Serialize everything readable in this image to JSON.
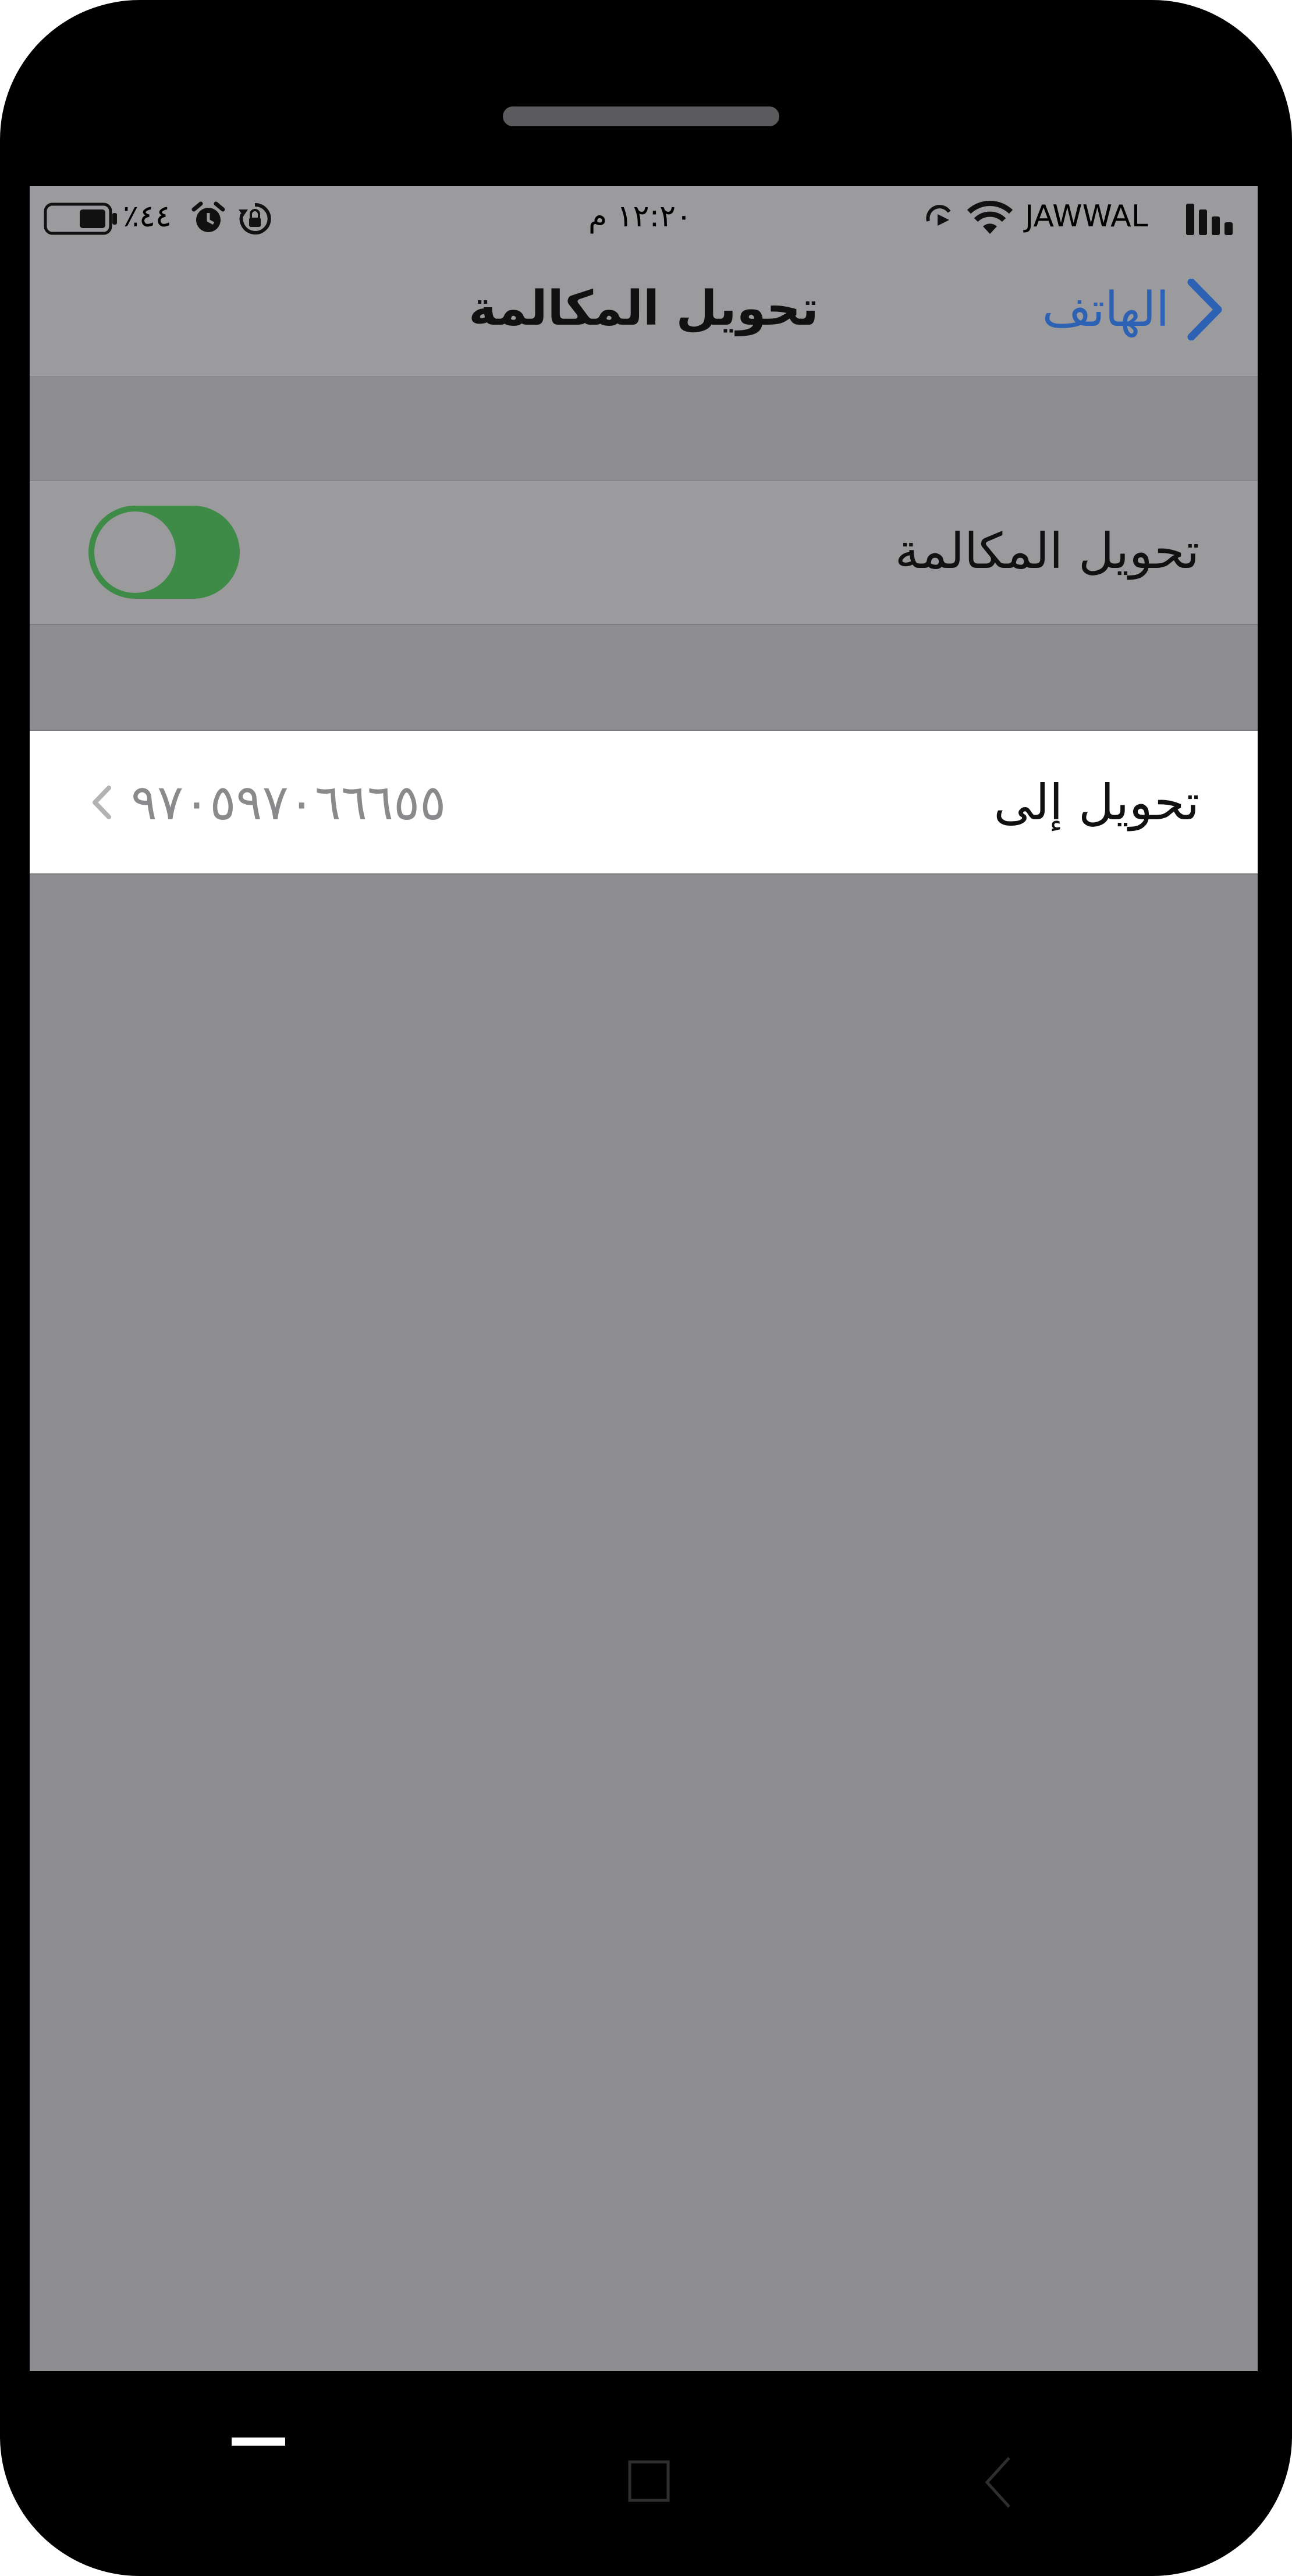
{
  "status_bar": {
    "carrier": "JAWWAL",
    "time": "١٢:٢٠ م",
    "battery": "٪٤٤",
    "icons": [
      "signal-bars-icon",
      "wifi-icon",
      "call-forward-icon",
      "rotation-lock-icon",
      "alarm-icon",
      "battery-icon"
    ]
  },
  "nav": {
    "back_label": "الهاتف",
    "title": "تحويل المكالمة"
  },
  "settings": {
    "forwarding": {
      "label": "تحويل المكالمة",
      "enabled": true
    },
    "forward_to": {
      "label": "تحويل إلى",
      "value": "٩٧٠٥٩٧٠٦٦٦٥٥"
    }
  },
  "system_nav": {
    "icons": [
      "menu-icon",
      "home-square-icon",
      "back-chevron-icon"
    ]
  },
  "colors": {
    "accent_blue": "#2d61b3",
    "toggle_green": "#3e8a47",
    "dim_overlay": "#8e8e90",
    "row_highlight": "#ffffff"
  }
}
